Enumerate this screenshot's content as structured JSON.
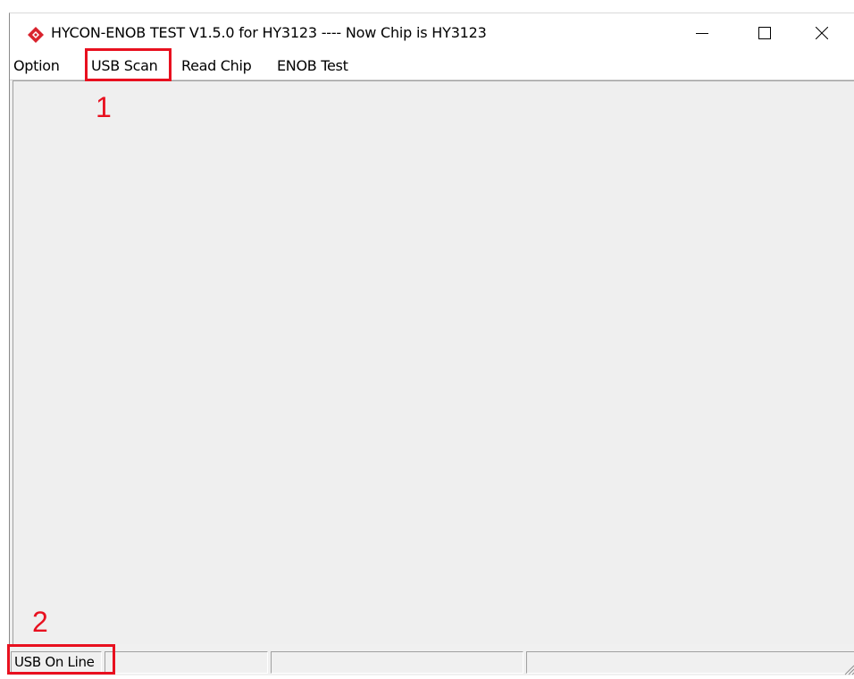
{
  "window": {
    "title": "HYCON-ENOB TEST V1.5.0 for HY3123 ---- Now Chip is  HY3123",
    "icon": "hycon-diamond-icon",
    "icon_color": "#d9232d",
    "controls": [
      "minimize-icon",
      "maximize-icon",
      "close-icon"
    ]
  },
  "menu": {
    "items": [
      {
        "label": "Option"
      },
      {
        "label": "USB Scan"
      },
      {
        "label": "Read Chip"
      },
      {
        "label": "ENOB Test"
      }
    ]
  },
  "status_bar": {
    "panels": [
      "USB On Line",
      "",
      "",
      ""
    ]
  },
  "annotations": {
    "color": "#e8101f",
    "callouts": [
      "1",
      "2"
    ]
  }
}
